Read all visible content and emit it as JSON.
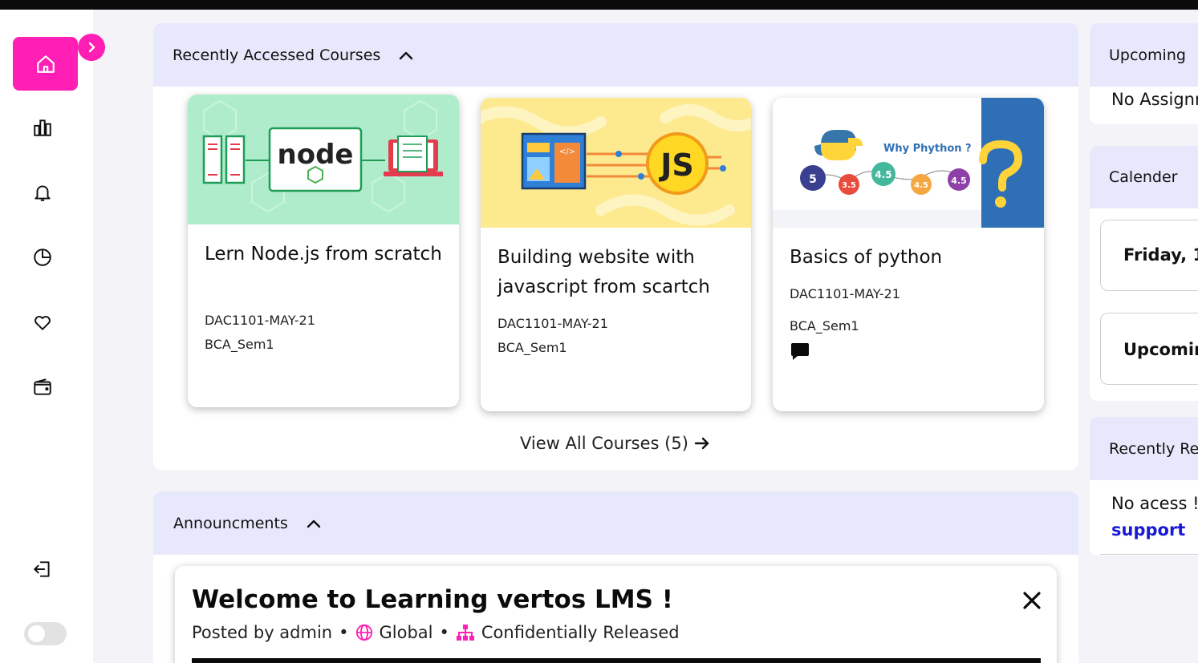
{
  "sidebar": {
    "nav": [
      {
        "name": "home-icon",
        "label": "Home"
      },
      {
        "name": "bar-chart-icon",
        "label": "Reports"
      },
      {
        "name": "bell-icon",
        "label": "Notifications"
      },
      {
        "name": "pie-chart-icon",
        "label": "Analytics"
      },
      {
        "name": "heart-icon",
        "label": "Favorites"
      },
      {
        "name": "wallet-icon",
        "label": "Wallet"
      },
      {
        "name": "logout-icon",
        "label": "Logout"
      }
    ],
    "theme_toggle_on": false
  },
  "courses_panel": {
    "title": "Recently Accessed Courses",
    "view_all": "View All Courses (5)",
    "cards": [
      {
        "title": "Lern Node.js from scratch",
        "code": "DAC1101-MAY-21",
        "batch": "BCA_Sem1",
        "image": "node.js illustration"
      },
      {
        "title": "Building website with javascript from scartch",
        "code": "DAC1101-MAY-21",
        "batch": "BCA_Sem1",
        "image": "javascript illustration"
      },
      {
        "title": "Basics of python",
        "code": "DAC1101-MAY-21",
        "batch": "BCA_Sem1",
        "image": "python illustration",
        "image_text": {
          "heading": "Why Phython ?",
          "ratings": [
            "5",
            "3.5",
            "4.5",
            "4.5",
            "4.5"
          ]
        }
      }
    ]
  },
  "announcements_panel": {
    "title": "Announcments",
    "item": {
      "title": "Welcome to Learning vertos LMS !",
      "posted_by": "Posted by admin",
      "scope": "Global",
      "release": "Confidentially Released"
    }
  },
  "right_column": {
    "upcoming": {
      "title": "Upcoming",
      "empty_text": "No Assignm"
    },
    "calendar": {
      "title": "Calender",
      "date_text": "Friday, 1",
      "upcoming_text": "Upcomin"
    },
    "recent": {
      "title": "Recently Re",
      "empty_text": "No acess !",
      "link_text": "support"
    }
  },
  "colors": {
    "accent": "#ff1fb4",
    "panel_header": "#e8e8fc",
    "link": "#1a1ad6"
  }
}
